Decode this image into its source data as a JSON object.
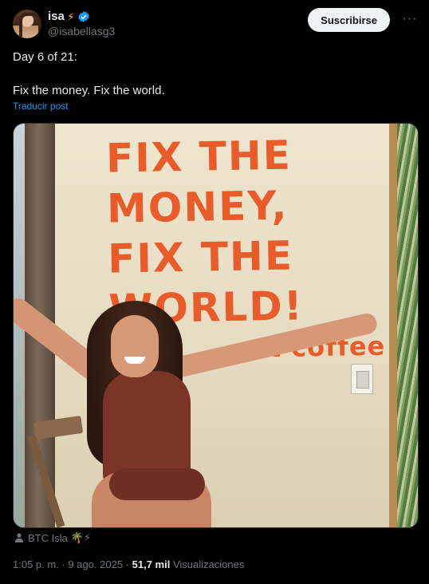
{
  "author": {
    "display_name": "isa",
    "name_emoji": "⚡",
    "handle": "@isabellasg3",
    "verified": true
  },
  "header": {
    "subscribe_label": "Suscribirse",
    "more_label": "···"
  },
  "tweet": {
    "line1": "Day 6 of 21:",
    "line2": "Fix the money. Fix the world.",
    "translate_label": "Traducir post"
  },
  "media": {
    "mural_lines": [
      "Fix THE",
      "MONEY,",
      "Fix THE",
      "WORLD!"
    ],
    "mural_small": "...t coffee"
  },
  "location": {
    "label": "BTC Isla",
    "emoji": "🌴⚡"
  },
  "meta": {
    "time": "1:05 p. m.",
    "separator": " · ",
    "date": "9 ago. 2025",
    "views_count": "51,7 mil",
    "views_label": "Visualizaciones"
  },
  "colors": {
    "background": "#000000",
    "text": "#e7e9ea",
    "secondary": "#71767b",
    "link": "#1d9bf0",
    "verified": "#1d9bf0",
    "bolt": "#f7a823",
    "mural": "#ea5b2a"
  }
}
